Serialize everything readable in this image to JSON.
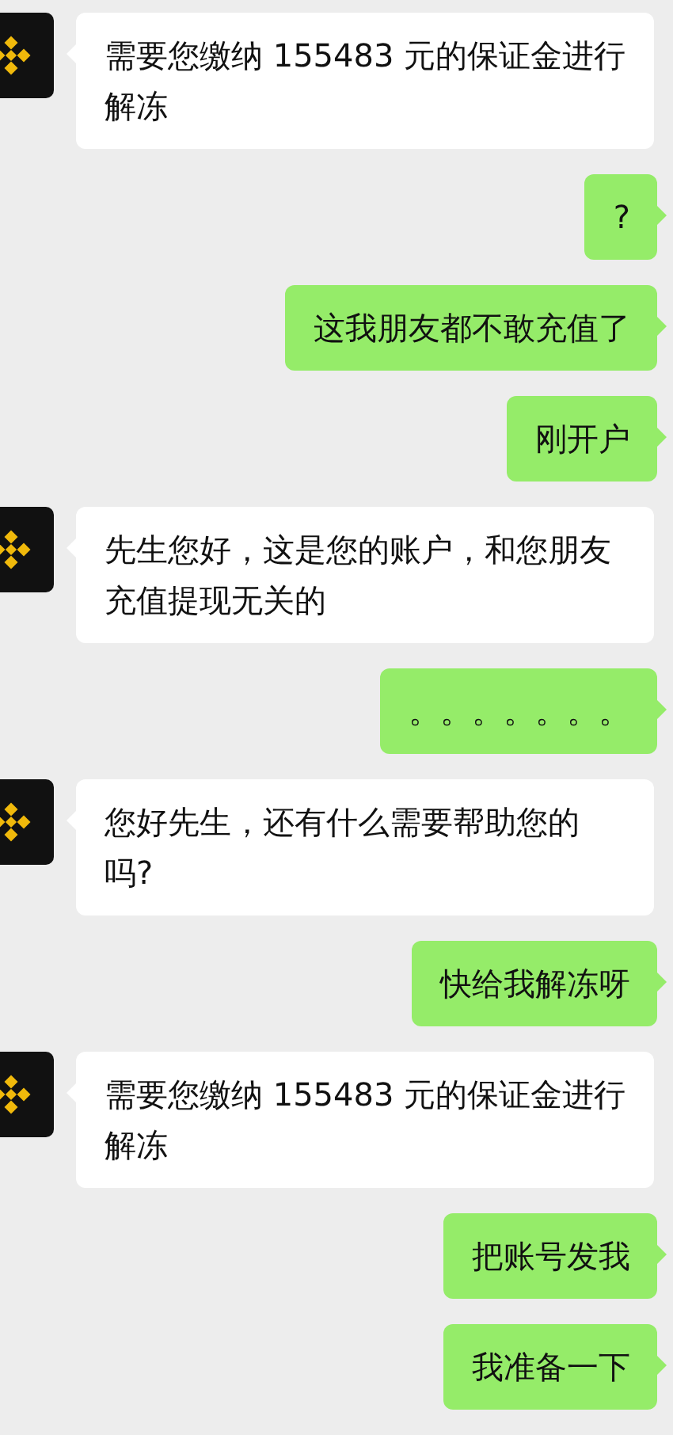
{
  "messages": [
    {
      "kind": "received",
      "text": "需要您缴纳 155483 元的保证金进行解冻"
    },
    {
      "kind": "sent",
      "text": "?"
    },
    {
      "kind": "sent",
      "text": "这我朋友都不敢充值了"
    },
    {
      "kind": "sent",
      "text": "刚开户"
    },
    {
      "kind": "received",
      "text": "先生您好，这是您的账户，和您朋友充值提现无关的"
    },
    {
      "kind": "sent",
      "text": "。。。。。。。"
    },
    {
      "kind": "received",
      "text": "您好先生，还有什么需要帮助您的吗?"
    },
    {
      "kind": "sent",
      "text": "快给我解冻呀"
    },
    {
      "kind": "received",
      "text": "需要您缴纳 155483 元的保证金进行解冻"
    },
    {
      "kind": "sent",
      "text": "把账号发我"
    },
    {
      "kind": "sent",
      "text": "我准备一下"
    }
  ]
}
